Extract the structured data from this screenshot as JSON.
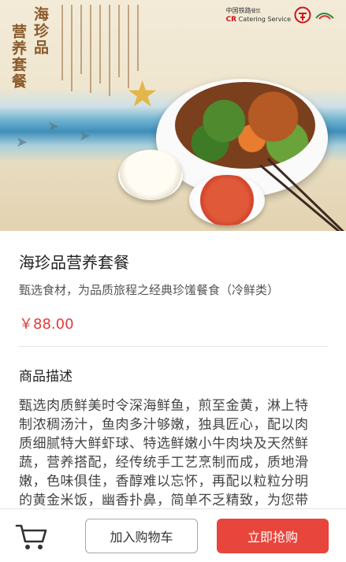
{
  "hero": {
    "title_line1": "海珍品",
    "title_line2": "营养套餐",
    "brand_name_cn": "中国铁路",
    "brand_suffix": "餐饮",
    "brand_en_prefix": "CR",
    "brand_en": "Catering Service"
  },
  "product": {
    "name": "海珍品营养套餐",
    "subtitle": "甄选食材，为品质旅程之经典珍馐餐食（冷鲜类）",
    "price": "￥88.00"
  },
  "description": {
    "heading": "商品描述",
    "body": "甄选肉质鲜美时令深海鲜鱼，煎至金黄，淋上特制浓稠汤汁，鱼肉多汁够嫩，独具匠心，配以肉质细腻特大鲜虾球、特选鲜嫩小牛肉块及天然鲜蔬，营养搭配，经传统手工艺烹制而成，质地滑嫩，色味俱佳，香醇难以忘怀，再配以粒粒分明的黄金米饭，幽香扑鼻，简单不乏精致，为您带来超凡的新鲜品质与饱满的口感。"
  },
  "actions": {
    "cart_icon": "shopping-cart-icon",
    "add_to_cart": "加入购物车",
    "buy_now": "立即抢购"
  },
  "colors": {
    "accent": "#e8453c",
    "price": "#e3393c"
  }
}
